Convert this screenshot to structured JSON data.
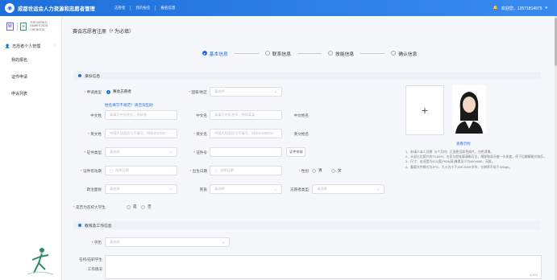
{
  "header": {
    "title": "成都世运会人力资源和志愿者管理",
    "nav": [
      "志愿者",
      "我的报名",
      "报名信息"
    ],
    "user_label": "欢迎您，13571814975"
  },
  "sidebar": {
    "group_label": "志愿者个人管理",
    "items": [
      "我的报名",
      "证件申请",
      "申诉列表"
    ],
    "logo_small_text": "THE WORLD GAMES 2025 CHENGDU"
  },
  "page": {
    "title": "赛会志愿者注册（* 为必填）"
  },
  "steps": [
    {
      "label": "基本信息",
      "active": true
    },
    {
      "label": "联系信息",
      "active": false
    },
    {
      "label": "技能信息",
      "active": false
    },
    {
      "label": "确认信息",
      "active": false
    }
  ],
  "sections": {
    "identity": "身份信息",
    "education": "教育及工作信息"
  },
  "form": {
    "applicant_type_label": "申请类型",
    "applicant_type_value": "赛会志愿者",
    "country_label": "国家/地区",
    "country_placeholder": "请选择",
    "name_tip": "姓名填写不规范？请咨询互助",
    "cn_name_label": "中文姓",
    "cn_name_placeholder": "请填写中文姓名，例如张",
    "cn_given_label": "中文名",
    "cn_given_placeholder": "请填写中文名字，例如某某",
    "cn_fullname_label": "中文姓名",
    "en_surname_label": "英文姓",
    "en_surname_placeholder": "中国大陆居民可不填写，例如ZHANG",
    "en_given_label": "英文名",
    "en_given_placeholder": "中国大陆居民可不填写，例如SANMOU",
    "en_fullname_label": "英文姓名",
    "id_type_label": "证件类型",
    "id_type_placeholder": "请选择",
    "id_no_label": "证件号",
    "id_check_button": "证件申核",
    "id_expiry_label": "证件有效期",
    "id_expiry_placeholder": "选择日期",
    "birth_label": "出生日期",
    "birth_placeholder": "选择日期",
    "gender_label": "性别",
    "gender_options": [
      "男",
      "女"
    ],
    "political_label": "政治面貌",
    "political_placeholder": "请选择",
    "ethnicity_label": "民族",
    "ethnicity_placeholder": "请选择",
    "volunteer_type_label": "志愿者类型",
    "volunteer_type_placeholder": "请选择",
    "student_label": "是否为在校大学生",
    "student_options": [
      "是",
      "否"
    ],
    "degree_label": "学历",
    "degree_placeholder": "请选择",
    "job_label": "在校/在职学生",
    "job_label2": "工作情况",
    "job_counter": "0/300"
  },
  "photo": {
    "plus": "+",
    "sample_caption": "查看示例",
    "notes": [
      "1、申请人本人近期（6个月内）正面免冠彩色照片，白色背景。",
      "2、头部占比照片的70-80%；五官与脸轮廓清晰可见，眼部和耳朵被一头发遮，停下后眼睛能光和反。",
      "3、尺寸：必须是为413(宽)*626(高)像素至少为480x640，无框。",
      "4、重要文件格式为JPG，大小为小于20K-300K字节，分辨率不低于300dpi。"
    ]
  },
  "colors": {
    "brand": "#1e6fd9",
    "required": "#e24a4a"
  }
}
